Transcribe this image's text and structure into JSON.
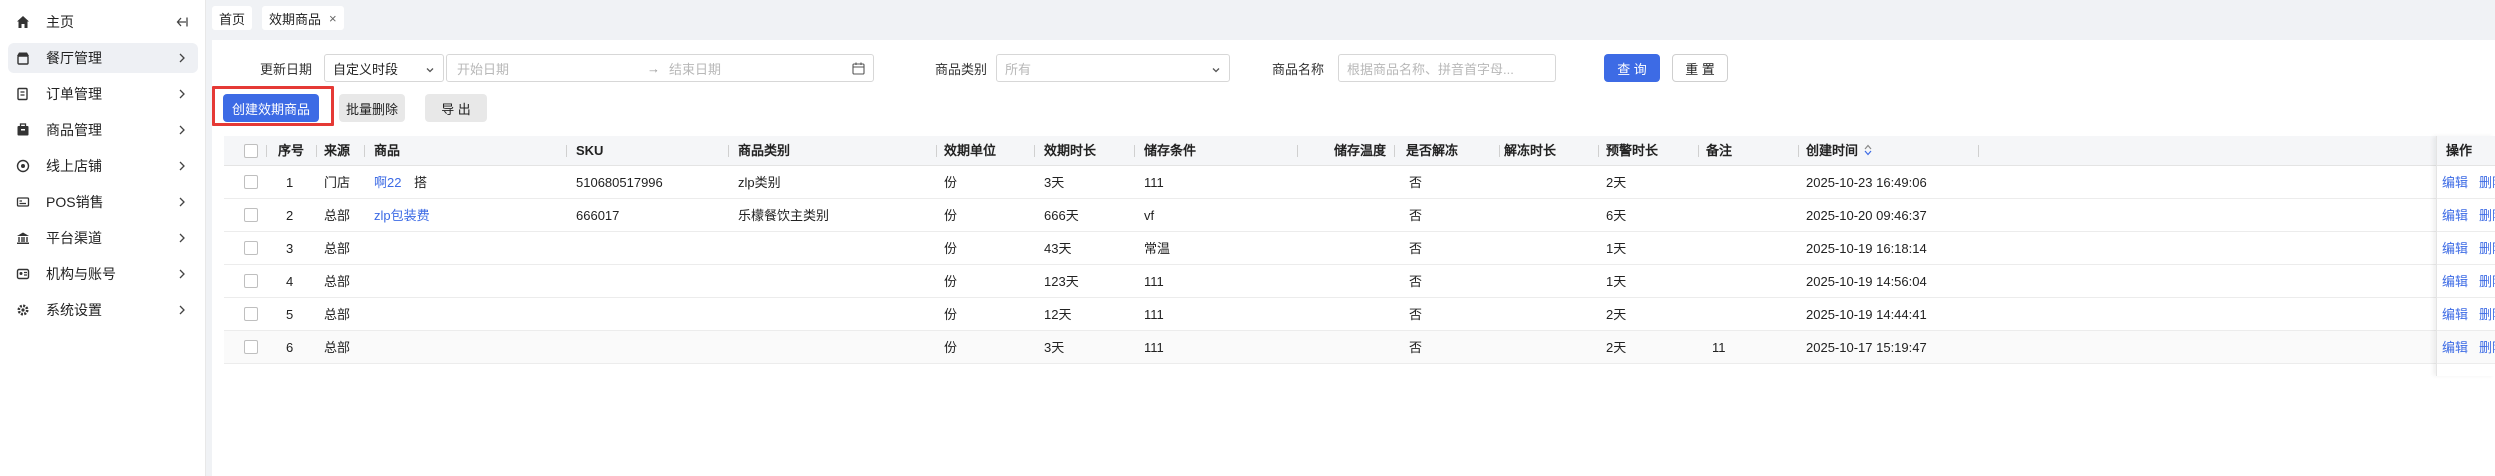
{
  "sidebar": {
    "items": [
      {
        "label": "主页",
        "icon": "home-icon"
      },
      {
        "label": "餐厅管理",
        "icon": "restaurant-icon"
      },
      {
        "label": "订单管理",
        "icon": "order-icon"
      },
      {
        "label": "商品管理",
        "icon": "product-icon"
      },
      {
        "label": "线上店铺",
        "icon": "online-store-icon"
      },
      {
        "label": "POS销售",
        "icon": "pos-icon"
      },
      {
        "label": "平台渠道",
        "icon": "bank-icon"
      },
      {
        "label": "机构与账号",
        "icon": "account-icon"
      },
      {
        "label": "系统设置",
        "icon": "gear-icon"
      }
    ]
  },
  "tabs": [
    {
      "label": "首页"
    },
    {
      "label": "效期商品",
      "close": "×"
    }
  ],
  "filters": {
    "date_label": "更新日期",
    "date_mode": "自定义时段",
    "start_placeholder": "开始日期",
    "range_arrow": "→",
    "end_placeholder": "结束日期",
    "category_label": "商品类别",
    "category_value": "所有",
    "name_label": "商品名称",
    "name_placeholder": "根据商品名称、拼音首字母...",
    "search_btn": "查 询",
    "reset_btn": "重 置"
  },
  "actions": {
    "create": "创建效期商品",
    "batch_delete": "批量删除",
    "export": "导 出"
  },
  "table": {
    "headers": [
      "序号",
      "来源",
      "商品",
      "SKU",
      "商品类别",
      "效期单位",
      "效期时长",
      "储存条件",
      "储存温度",
      "是否解冻",
      "解冻时长",
      "预警时长",
      "备注",
      "创建时间",
      "操作"
    ],
    "edit_label": "编辑",
    "delete_label": "删除",
    "rows": [
      {
        "no": "1",
        "source": "门店",
        "product": "啊22",
        "product_extra": "搭",
        "sku": "510680517996",
        "category": "zlp类别",
        "unit": "份",
        "duration": "3天",
        "storage": "111",
        "temp": "",
        "thaw": "否",
        "thaw_time": "",
        "warn": "2天",
        "note": "",
        "created": "2025-10-23 16:49:06"
      },
      {
        "no": "2",
        "source": "总部",
        "product": "zlp包装费",
        "product_extra": "",
        "sku": "666017",
        "category": "乐檬餐饮主类别",
        "unit": "份",
        "duration": "666天",
        "storage": "vf",
        "temp": "",
        "thaw": "否",
        "thaw_time": "",
        "warn": "6天",
        "note": "",
        "created": "2025-10-20 09:46:37"
      },
      {
        "no": "3",
        "source": "总部",
        "product": "",
        "product_extra": "",
        "sku": "",
        "category": "",
        "unit": "份",
        "duration": "43天",
        "storage": "常温",
        "temp": "",
        "thaw": "否",
        "thaw_time": "",
        "warn": "1天",
        "note": "",
        "created": "2025-10-19 16:18:14"
      },
      {
        "no": "4",
        "source": "总部",
        "product": "",
        "product_extra": "",
        "sku": "",
        "category": "",
        "unit": "份",
        "duration": "123天",
        "storage": "111",
        "temp": "",
        "thaw": "否",
        "thaw_time": "",
        "warn": "1天",
        "note": "",
        "created": "2025-10-19 14:56:04"
      },
      {
        "no": "5",
        "source": "总部",
        "product": "",
        "product_extra": "",
        "sku": "",
        "category": "",
        "unit": "份",
        "duration": "12天",
        "storage": "111",
        "temp": "",
        "thaw": "否",
        "thaw_time": "",
        "warn": "2天",
        "note": "",
        "created": "2025-10-19 14:44:41"
      },
      {
        "no": "6",
        "source": "总部",
        "product": "",
        "product_extra": "",
        "sku": "",
        "category": "",
        "unit": "份",
        "duration": "3天",
        "storage": "111",
        "temp": "",
        "thaw": "否",
        "thaw_time": "",
        "warn": "2天",
        "note": "11",
        "created": "2025-10-17 15:19:47"
      }
    ]
  },
  "colors": {
    "primary": "#3d6be5",
    "highlight": "#e53935",
    "link": "#3d6be5"
  }
}
